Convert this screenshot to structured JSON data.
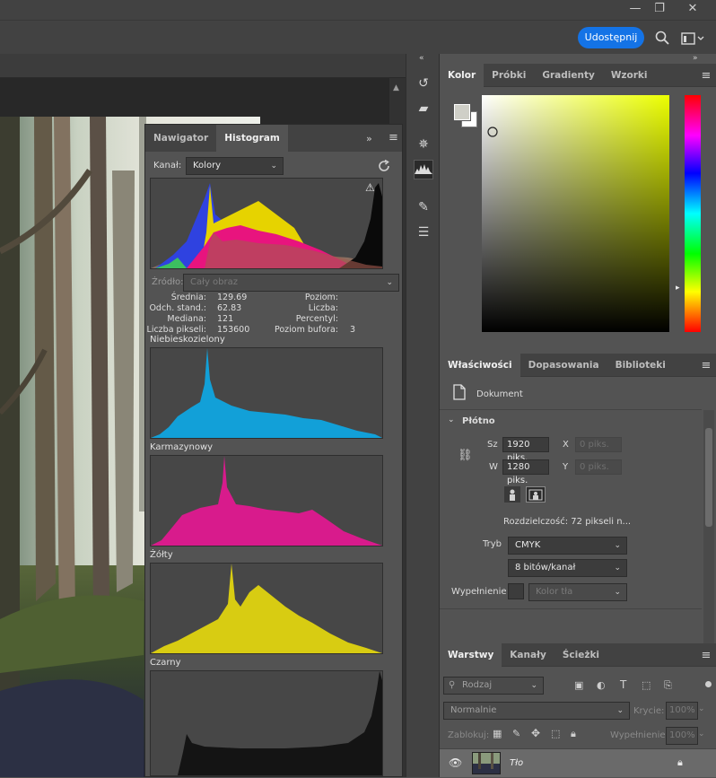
{
  "window": {
    "minimize": "—",
    "restore": "❐",
    "close": "✕"
  },
  "optionsbar": {
    "share_label": "Udostępnij",
    "search_icon": "search-icon",
    "workspace_icon": "workspace-icon"
  },
  "histogram_panel": {
    "tabs": [
      "Nawigator",
      "Histogram"
    ],
    "active_tab": "Histogram",
    "channel_label": "Kanał:",
    "channel_value": "Kolory",
    "source_label": "Źródło:",
    "source_value": "Cały obraz",
    "stats_left": [
      {
        "label": "Średnia:",
        "value": "129.69"
      },
      {
        "label": "Odch. stand.:",
        "value": "62.83"
      },
      {
        "label": "Mediana:",
        "value": "121"
      },
      {
        "label": "Liczba pikseli:",
        "value": "153600"
      }
    ],
    "stats_right": [
      {
        "label": "Poziom:",
        "value": ""
      },
      {
        "label": "Liczba:",
        "value": ""
      },
      {
        "label": "Percentyl:",
        "value": ""
      },
      {
        "label": "Poziom bufora:",
        "value": "3"
      }
    ],
    "channels": [
      {
        "name": "Niebieskozielony",
        "color": "#12a0d8"
      },
      {
        "name": "Karmazynowy",
        "color": "#d81b8c"
      },
      {
        "name": "Żółty",
        "color": "#d8cc12"
      },
      {
        "name": "Czarny",
        "color": "#141414"
      }
    ]
  },
  "color_panel": {
    "tabs": [
      "Kolor",
      "Próbki",
      "Gradienty",
      "Wzorki"
    ],
    "active_tab": "Kolor",
    "hue_color": "#ecff00"
  },
  "properties_panel": {
    "tabs": [
      "Właściwości",
      "Dopasowania",
      "Biblioteki"
    ],
    "active_tab": "Właściwości",
    "doc_label": "Dokument",
    "section_title": "Płótno",
    "width_label": "Sz",
    "width_value": "1920 piks.",
    "height_label": "W",
    "height_value": "1280 piks.",
    "x_label": "X",
    "x_placeholder": "0 piks.",
    "y_label": "Y",
    "y_placeholder": "0 piks.",
    "resolution": "Rozdzielczość:  72 pikseli n...",
    "mode_label": "Tryb",
    "mode_value": "CMYK",
    "depth_value": "8 bitów/kanał",
    "fill_label": "Wypełnienie",
    "fill_value": "Kolor tła"
  },
  "layers_panel": {
    "tabs": [
      "Warstwy",
      "Kanały",
      "Ścieżki"
    ],
    "active_tab": "Warstwy",
    "filter_value": "Rodzaj",
    "blend_value": "Normalnie",
    "opacity_label": "Krycie:",
    "opacity_value": "100%",
    "lock_label": "Zablokuj:",
    "fill_label": "Wypełnienie:",
    "fill_value": "100%",
    "layers": [
      {
        "name": "Tło"
      }
    ]
  }
}
